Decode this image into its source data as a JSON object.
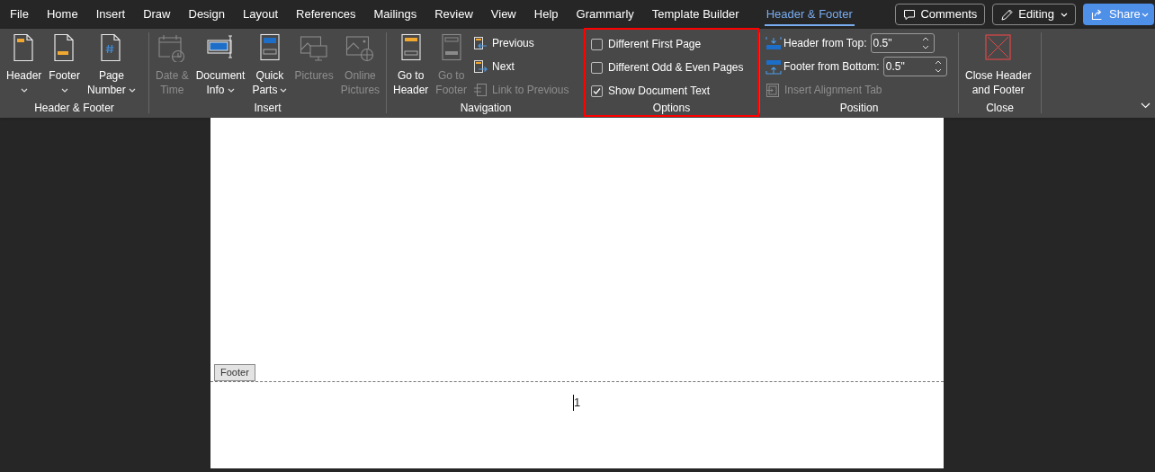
{
  "menu_tabs": [
    {
      "label": "File",
      "selected": false
    },
    {
      "label": "Home",
      "selected": false
    },
    {
      "label": "Insert",
      "selected": false
    },
    {
      "label": "Draw",
      "selected": false
    },
    {
      "label": "Design",
      "selected": false
    },
    {
      "label": "Layout",
      "selected": false
    },
    {
      "label": "References",
      "selected": false
    },
    {
      "label": "Mailings",
      "selected": false
    },
    {
      "label": "Review",
      "selected": false
    },
    {
      "label": "View",
      "selected": false
    },
    {
      "label": "Help",
      "selected": false
    },
    {
      "label": "Grammarly",
      "selected": false
    },
    {
      "label": "Template Builder",
      "selected": false
    },
    {
      "label": "Header & Footer",
      "selected": true
    }
  ],
  "top_actions": [
    {
      "label": "Comments",
      "kind": "comments"
    },
    {
      "label": "Editing",
      "kind": "editing"
    },
    {
      "label": "Share",
      "kind": "share"
    }
  ],
  "ribbon_groups": [
    {
      "label": "Header & Footer",
      "highlighted": false,
      "items": [
        {
          "kind": "large",
          "lines": [
            "Header"
          ],
          "dropdown": true,
          "disabled": false
        },
        {
          "kind": "large",
          "lines": [
            "Footer"
          ],
          "dropdown": true,
          "disabled": false
        },
        {
          "kind": "large",
          "lines": [
            "Page",
            "Number"
          ],
          "dropdown": true,
          "disabled": false
        }
      ]
    },
    {
      "label": "Insert",
      "highlighted": false,
      "items": [
        {
          "kind": "large",
          "lines": [
            "Date &",
            "Time"
          ],
          "dropdown": false,
          "disabled": true
        },
        {
          "kind": "large",
          "lines": [
            "Document",
            "Info"
          ],
          "dropdown": true,
          "disabled": false
        },
        {
          "kind": "large",
          "lines": [
            "Quick",
            "Parts"
          ],
          "dropdown": true,
          "disabled": false
        },
        {
          "kind": "large",
          "lines": [
            "Pictures"
          ],
          "dropdown": false,
          "disabled": true
        },
        {
          "kind": "large",
          "lines": [
            "Online",
            "Pictures"
          ],
          "dropdown": false,
          "disabled": true
        }
      ]
    },
    {
      "label": "Navigation",
      "highlighted": false,
      "items": [
        {
          "kind": "large",
          "lines": [
            "Go to",
            "Header"
          ],
          "dropdown": false,
          "disabled": false
        },
        {
          "kind": "large",
          "lines": [
            "Go to",
            "Footer"
          ],
          "dropdown": false,
          "disabled": true
        },
        {
          "kind": "stack",
          "rows": [
            {
              "kind": "small",
              "label": "Previous",
              "disabled": false
            },
            {
              "kind": "small",
              "label": "Next",
              "disabled": false
            },
            {
              "kind": "small",
              "label": "Link to Previous",
              "disabled": true
            }
          ]
        }
      ]
    },
    {
      "label": "Options",
      "highlighted": true,
      "items": [
        {
          "kind": "stack",
          "rows": [
            {
              "kind": "checkbox",
              "label": "Different First Page",
              "checked": false
            },
            {
              "kind": "checkbox",
              "label": "Different Odd & Even Pages",
              "checked": false
            },
            {
              "kind": "checkbox",
              "label": "Show Document Text",
              "checked": true
            }
          ]
        }
      ]
    },
    {
      "label": "Position",
      "highlighted": false,
      "items": [
        {
          "kind": "stack",
          "rows": [
            {
              "kind": "spinner",
              "label": "Header from Top:",
              "value": "0.5\""
            },
            {
              "kind": "spinner",
              "label": "Footer from Bottom:",
              "value": "0.5\""
            },
            {
              "kind": "small",
              "label": "Insert Alignment Tab",
              "disabled": true
            }
          ]
        }
      ]
    },
    {
      "label": "Close",
      "highlighted": false,
      "items": [
        {
          "kind": "large",
          "lines": [
            "Close Header",
            "and Footer"
          ],
          "dropdown": false,
          "disabled": false
        }
      ]
    }
  ],
  "document": {
    "footer_tag": "Footer",
    "page_number": "1"
  }
}
